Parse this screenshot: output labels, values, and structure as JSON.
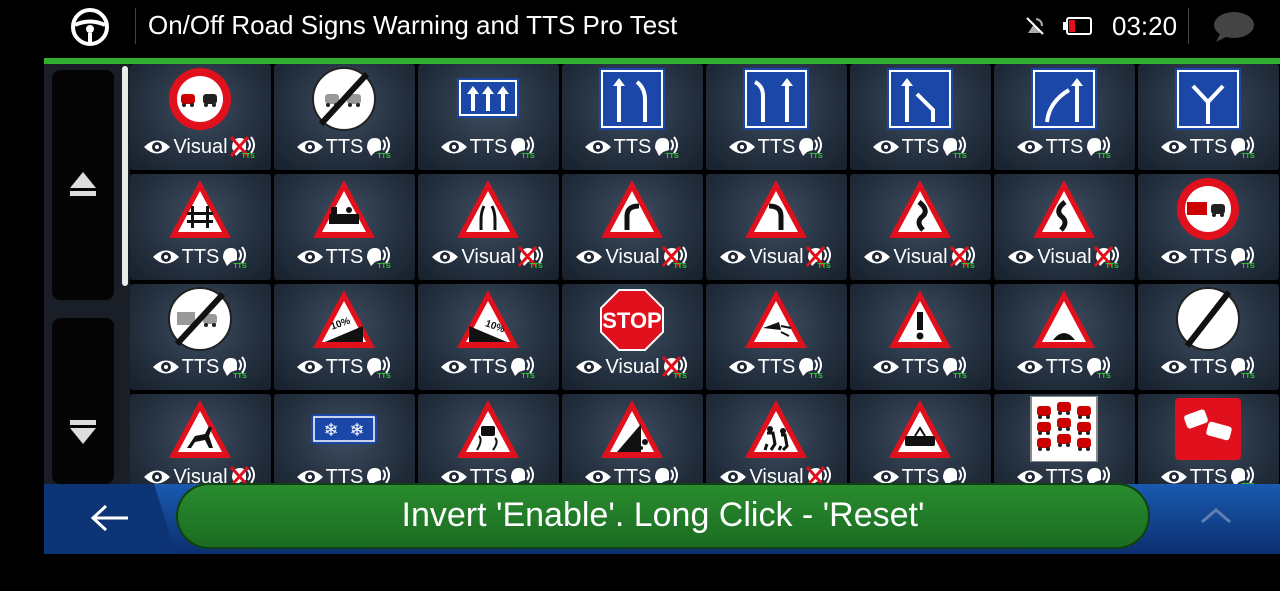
{
  "header": {
    "title": "On/Off Road Signs Warning and TTS Pro Test",
    "time": "03:20"
  },
  "colors": {
    "accent_green": "#2fb12f",
    "sign_red": "#e0101d",
    "sign_blue": "#1a47a8",
    "tts_green": "#2fd12f"
  },
  "sidebar": {
    "scroll_up": "eject-up-icon",
    "scroll_down": "triangle-down-icon"
  },
  "grid": {
    "rows": [
      [
        {
          "sign": "no-overtaking",
          "status": "Visual",
          "voice": "muted"
        },
        {
          "sign": "end-no-overtaking",
          "status": "TTS",
          "voice": "tts"
        },
        {
          "sign": "lanes-three-straight",
          "status": "TTS",
          "voice": "tts"
        },
        {
          "sign": "lanes-straight-merge",
          "status": "TTS",
          "voice": "tts"
        },
        {
          "sign": "lanes-left-straight",
          "status": "TTS",
          "voice": "tts"
        },
        {
          "sign": "lanes-straight-left",
          "status": "TTS",
          "voice": "tts"
        },
        {
          "sign": "lanes-right-straight",
          "status": "TTS",
          "voice": "tts"
        },
        {
          "sign": "lanes-split",
          "status": "TTS",
          "voice": "tts"
        }
      ],
      [
        {
          "sign": "level-crossing-gate",
          "status": "TTS",
          "voice": "tts"
        },
        {
          "sign": "level-crossing-train",
          "status": "TTS",
          "voice": "tts"
        },
        {
          "sign": "road-narrows",
          "status": "Visual",
          "voice": "muted"
        },
        {
          "sign": "curve-right",
          "status": "Visual",
          "voice": "muted"
        },
        {
          "sign": "curve-left",
          "status": "Visual",
          "voice": "muted"
        },
        {
          "sign": "double-curve-left",
          "status": "Visual",
          "voice": "muted"
        },
        {
          "sign": "double-curve-right",
          "status": "Visual",
          "voice": "muted"
        },
        {
          "sign": "no-overtaking-trucks",
          "status": "TTS",
          "voice": "tts"
        }
      ],
      [
        {
          "sign": "end-no-overtaking-trucks",
          "status": "TTS",
          "voice": "tts"
        },
        {
          "sign": "steep-ascent",
          "status": "TTS",
          "voice": "tts"
        },
        {
          "sign": "steep-descent",
          "status": "TTS",
          "voice": "tts"
        },
        {
          "sign": "stop",
          "status": "Visual",
          "voice": "muted"
        },
        {
          "sign": "crosswind",
          "status": "TTS",
          "voice": "tts"
        },
        {
          "sign": "general-danger",
          "status": "TTS",
          "voice": "tts"
        },
        {
          "sign": "speed-bump",
          "status": "TTS",
          "voice": "tts"
        },
        {
          "sign": "end-all-restrictions",
          "status": "TTS",
          "voice": "tts"
        }
      ],
      [
        {
          "sign": "deer-crossing",
          "status": "Visual",
          "voice": "muted"
        },
        {
          "sign": "snow-ice",
          "status": "TTS",
          "voice": "tts"
        },
        {
          "sign": "slippery-road",
          "status": "TTS",
          "voice": "tts"
        },
        {
          "sign": "falling-rocks",
          "status": "TTS",
          "voice": "tts"
        },
        {
          "sign": "school-children",
          "status": "Visual",
          "voice": "muted"
        },
        {
          "sign": "tram-crossing",
          "status": "TTS",
          "voice": "tts"
        },
        {
          "sign": "traffic-jam",
          "status": "TTS",
          "voice": "tts"
        },
        {
          "sign": "accident",
          "status": "TTS",
          "voice": "tts"
        }
      ]
    ]
  },
  "bottom": {
    "back_icon": "arrow-left-icon",
    "up_icon": "chevron-up-icon"
  },
  "toast": {
    "message": "Invert 'Enable'. Long Click - 'Reset'"
  },
  "mini_label": "TTS",
  "sign_text": {
    "stop": "STOP",
    "percent": "10%"
  }
}
